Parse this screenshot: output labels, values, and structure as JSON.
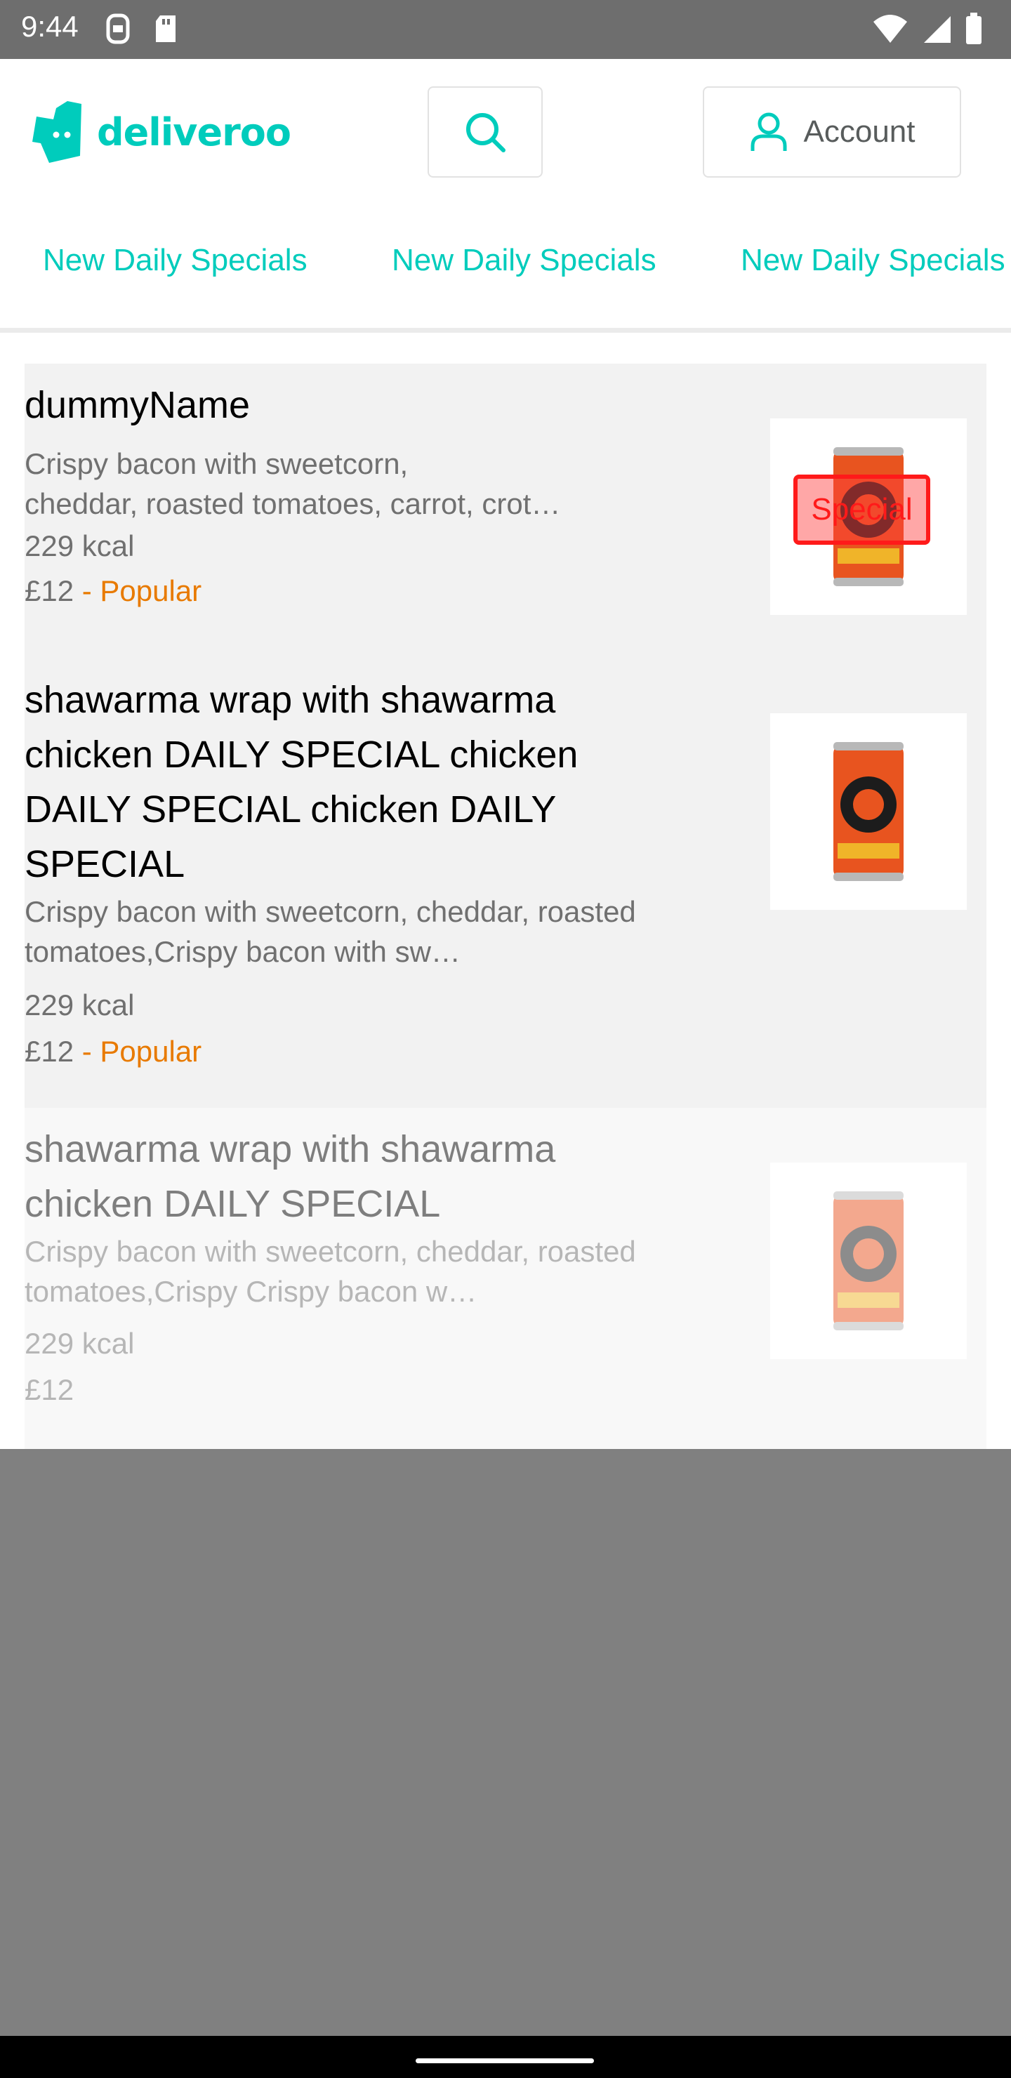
{
  "status_bar": {
    "time": "9:44",
    "left_icons": [
      "notification-icon",
      "sd-card-icon"
    ],
    "right_icons": [
      "wifi-icon",
      "signal-icon",
      "battery-icon"
    ]
  },
  "header": {
    "logo_text": "deliveroo",
    "account_label": "Account"
  },
  "tabs": [
    "New Daily Specials",
    "New Daily Specials",
    "New Daily Specials"
  ],
  "items": [
    {
      "title": "dummyName",
      "description": "Crispy bacon with sweetcorn,\ncheddar, roasted tomatoes,  carrot, crot…",
      "kcal": "229 kcal",
      "price": "£12",
      "tag": "- Popular",
      "badge": "Special",
      "image": "ginger-beer-can"
    },
    {
      "title": "shawarma wrap with shawarma chicken DAILY SPECIAL chicken DAILY SPECIAL chicken DAILY SPECIAL",
      "description": "Crispy bacon with sweetcorn, cheddar, roasted tomatoes,Crispy bacon with sw…",
      "kcal": "229 kcal",
      "price": "£12",
      "tag": "- Popular",
      "image": "ginger-beer-can"
    },
    {
      "title": "shawarma wrap with shawarma chicken DAILY SPECIAL",
      "description": "Crispy bacon with sweetcorn, cheddar, roasted tomatoes,Crispy Crispy bacon w…",
      "kcal": "229 kcal",
      "price": "£12",
      "image": "ginger-beer-can",
      "unavailable": true
    }
  ],
  "colors": {
    "brand": "#00ccbc",
    "popular": "#e87a00",
    "badge": "#ff1a1a",
    "scrim": "#808080"
  }
}
